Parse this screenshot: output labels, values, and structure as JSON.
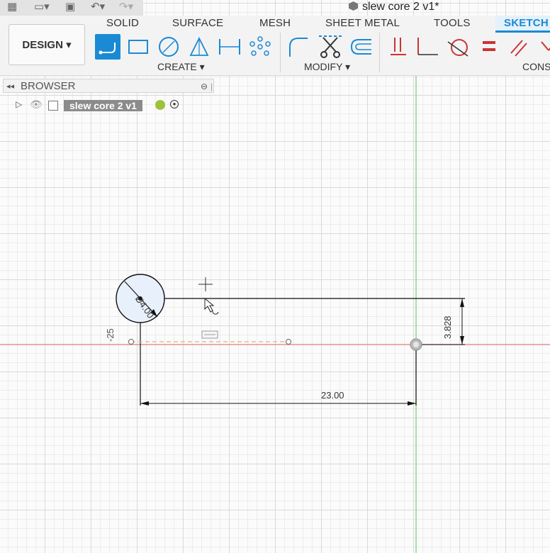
{
  "title": "slew core 2 v1*",
  "toolbar": {
    "design_label": "DESIGN",
    "tabs": [
      "SOLID",
      "SURFACE",
      "MESH",
      "SHEET METAL",
      "TOOLS",
      "SKETCH"
    ],
    "groups": {
      "create": "CREATE",
      "modify": "MODIFY",
      "constraints": "CONS"
    }
  },
  "browser": {
    "label": "BROWSER",
    "component": "slew core 2 v1"
  },
  "sketch": {
    "dim_horizontal": "23.00",
    "dim_vertical": "3.828",
    "dim_diameter": "Ø4.00",
    "dim_small": "-25"
  },
  "colors": {
    "accent": "#1a8ad4",
    "x_axis": "#e05050",
    "y_axis": "#4fc24f"
  }
}
